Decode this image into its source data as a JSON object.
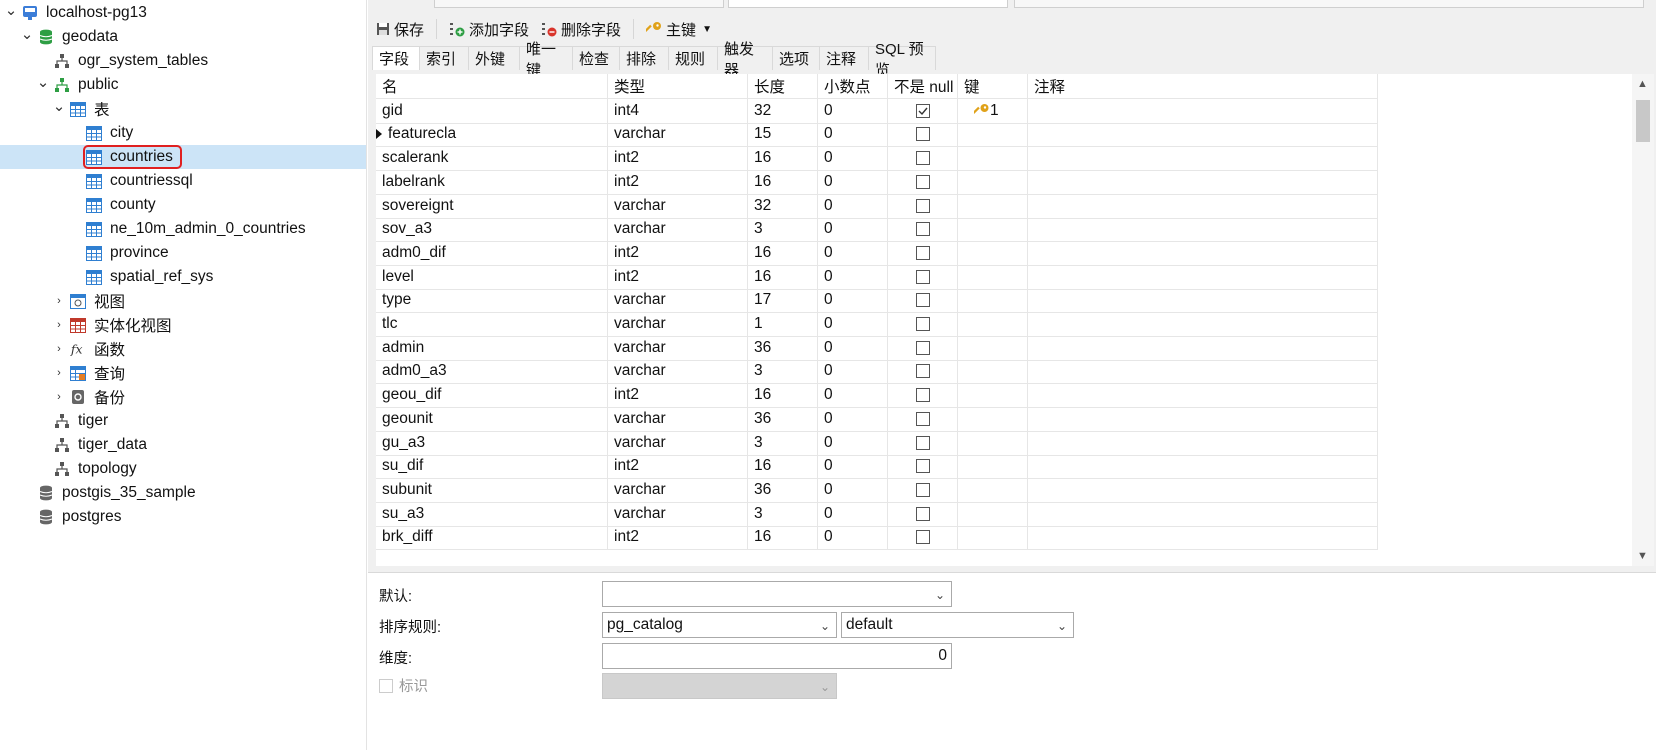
{
  "sidebar": {
    "server": "localhost-pg13",
    "database": "geodata",
    "ogr_schema": "ogr_system_tables",
    "schema": "public",
    "tables_folder": "表",
    "tables": [
      "city",
      "countries",
      "countriessql",
      "county",
      "ne_10m_admin_0_countries",
      "province",
      "spatial_ref_sys"
    ],
    "selected_table": "countries",
    "folders": [
      "视图",
      "实体化视图",
      "函数",
      "查询",
      "备份"
    ],
    "other_schemas": [
      "tiger",
      "tiger_data",
      "topology"
    ],
    "other_databases": [
      "postgis_35_sample",
      "postgres"
    ]
  },
  "toolbar": {
    "save": "保存",
    "add_field": "添加字段",
    "delete_field": "删除字段",
    "primary_key": "主键"
  },
  "subtabs": [
    "字段",
    "索引",
    "外键",
    "唯一键",
    "检查",
    "排除",
    "规则",
    "触发器",
    "选项",
    "注释",
    "SQL 预览"
  ],
  "grid": {
    "headers": [
      "名",
      "类型",
      "长度",
      "小数点",
      "不是 null",
      "键",
      "注释"
    ],
    "rows": [
      {
        "name": "gid",
        "type": "int4",
        "length": "32",
        "decimal": "0",
        "not_null": true,
        "key": "1"
      },
      {
        "name": "featurecla",
        "type": "varchar",
        "length": "15",
        "decimal": "0",
        "not_null": false,
        "key": ""
      },
      {
        "name": "scalerank",
        "type": "int2",
        "length": "16",
        "decimal": "0",
        "not_null": false,
        "key": ""
      },
      {
        "name": "labelrank",
        "type": "int2",
        "length": "16",
        "decimal": "0",
        "not_null": false,
        "key": ""
      },
      {
        "name": "sovereignt",
        "type": "varchar",
        "length": "32",
        "decimal": "0",
        "not_null": false,
        "key": ""
      },
      {
        "name": "sov_a3",
        "type": "varchar",
        "length": "3",
        "decimal": "0",
        "not_null": false,
        "key": ""
      },
      {
        "name": "adm0_dif",
        "type": "int2",
        "length": "16",
        "decimal": "0",
        "not_null": false,
        "key": ""
      },
      {
        "name": "level",
        "type": "int2",
        "length": "16",
        "decimal": "0",
        "not_null": false,
        "key": ""
      },
      {
        "name": "type",
        "type": "varchar",
        "length": "17",
        "decimal": "0",
        "not_null": false,
        "key": ""
      },
      {
        "name": "tlc",
        "type": "varchar",
        "length": "1",
        "decimal": "0",
        "not_null": false,
        "key": ""
      },
      {
        "name": "admin",
        "type": "varchar",
        "length": "36",
        "decimal": "0",
        "not_null": false,
        "key": ""
      },
      {
        "name": "adm0_a3",
        "type": "varchar",
        "length": "3",
        "decimal": "0",
        "not_null": false,
        "key": ""
      },
      {
        "name": "geou_dif",
        "type": "int2",
        "length": "16",
        "decimal": "0",
        "not_null": false,
        "key": ""
      },
      {
        "name": "geounit",
        "type": "varchar",
        "length": "36",
        "decimal": "0",
        "not_null": false,
        "key": ""
      },
      {
        "name": "gu_a3",
        "type": "varchar",
        "length": "3",
        "decimal": "0",
        "not_null": false,
        "key": ""
      },
      {
        "name": "su_dif",
        "type": "int2",
        "length": "16",
        "decimal": "0",
        "not_null": false,
        "key": ""
      },
      {
        "name": "subunit",
        "type": "varchar",
        "length": "36",
        "decimal": "0",
        "not_null": false,
        "key": ""
      },
      {
        "name": "su_a3",
        "type": "varchar",
        "length": "3",
        "decimal": "0",
        "not_null": false,
        "key": ""
      },
      {
        "name": "brk_diff",
        "type": "int2",
        "length": "16",
        "decimal": "0",
        "not_null": false,
        "key": ""
      }
    ]
  },
  "props": {
    "default_label": "默认:",
    "default_value": "",
    "collation_label": "排序规则:",
    "collation_schema": "pg_catalog",
    "collation_value": "default",
    "dimension_label": "维度:",
    "dimension_value": "0",
    "identity_label": "标识"
  },
  "colors": {
    "selection": "#cce4f7",
    "highlight_box": "#e02020",
    "table_icon": "#2f7fd1",
    "db_icon": "#2e9e44"
  }
}
